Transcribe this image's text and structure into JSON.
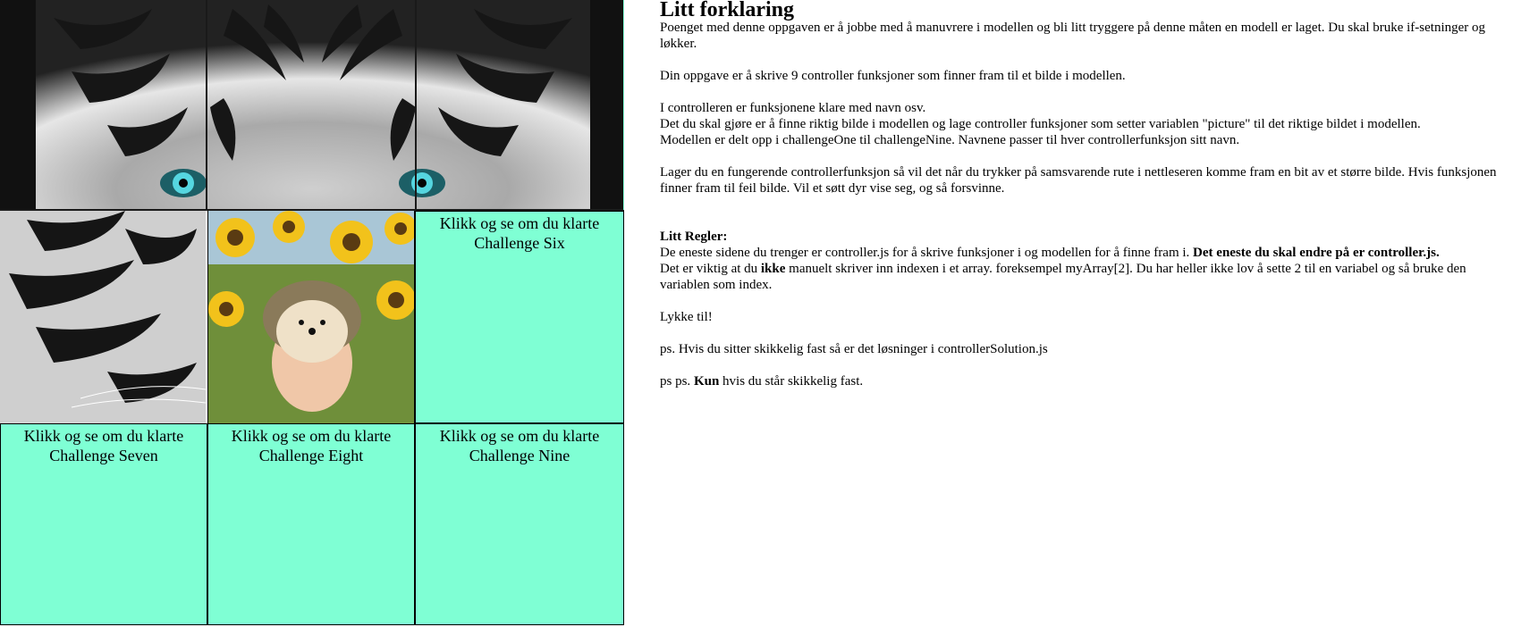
{
  "cells": {
    "six": "Klikk og se om du klarte Challenge Six",
    "seven": "Klikk og se om du klarte Challenge Seven",
    "eight": "Klikk og se om du klarte Challenge Eight",
    "nine": "Klikk og se om du klarte Challenge Nine"
  },
  "colors": {
    "cell_bg": "#7fffd4",
    "border": "#000000"
  },
  "explanation": {
    "title": "Litt forklaring",
    "p1": "Poenget med denne oppgaven er å jobbe med å manuvrere i modellen og bli litt tryggere på denne måten en modell er laget. Du skal bruke if-setninger og løkker.",
    "p2": "Din oppgave er å skrive 9 controller funksjoner som finner fram til et bilde i modellen.",
    "p3a": "I controlleren er funksjonene klare med navn osv.",
    "p3b": "Det du skal gjøre er å finne riktig bilde i modellen og lage controller funksjoner som setter variablen \"picture\" til det riktige bildet i modellen.",
    "p3c": "Modellen er delt opp i challengeOne til challengeNine. Navnene passer til hver controllerfunksjon sitt navn.",
    "p4": "Lager du en fungerende controllerfunksjon så vil det når du trykker på samsvarende rute i nettleseren komme fram en bit av et større bilde. Hvis funksjonen finner fram til feil bilde. Vil et søtt dyr vise seg, og så forsvinne."
  },
  "rules": {
    "title": "Litt Regler:",
    "r1_pre": "De eneste sidene du trenger er controller.js for å skrive funksjoner i og modellen for å finne fram i.",
    "r1_bold": "Det eneste du skal endre på er controller.js.",
    "r2_pre": "Det er viktig at du",
    "r2_bold": "ikke",
    "r2_post": "manuelt skriver inn indexen i et array. foreksempel myArray[2]. Du har heller ikke lov å sette 2 til en variabel og så bruke den variablen som index.",
    "luck": "Lykke til!",
    "ps": "ps. Hvis du sitter skikkelig fast så er det løsninger i controllerSolution.js",
    "psps_pre": "ps ps.",
    "psps_bold": "Kun",
    "psps_post": "hvis du står skikkelig fast."
  }
}
